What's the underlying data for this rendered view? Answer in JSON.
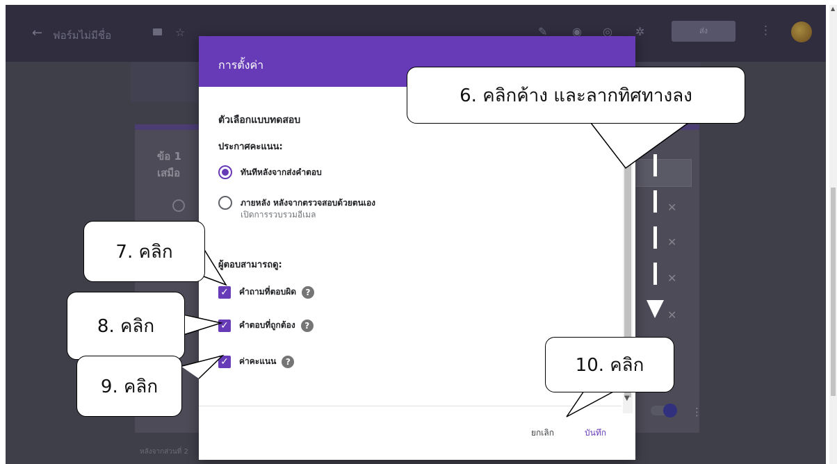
{
  "app": {
    "back_glyph": "←",
    "title": "ฟอร์มไม่มีชื่อ",
    "star_glyph": "☆",
    "send_label": "ส่ง",
    "more_glyph": "⋮",
    "footer_text": "หลังจากส่วนที่ 2",
    "question_number": "ข้อ 1",
    "question_text": "เสมือ"
  },
  "dialog": {
    "title": "การตั้งค่า",
    "section_title": "ตัวเลือกแบบทดสอบ",
    "release_label": "ประกาศคะแนน:",
    "release_options": [
      {
        "label": "ทันทีหลังจากส่งคำตอบ",
        "sub": "",
        "selected": true
      },
      {
        "label": "ภายหลัง หลังจากตรวจสอบด้วยตนเอง",
        "sub": "เปิดการรวบรวมอีเมล",
        "selected": false
      }
    ],
    "can_see_label": "ผู้ตอบสามารถดู:",
    "can_see_options": [
      {
        "label": "คำถามที่ตอบผิด",
        "checked": true
      },
      {
        "label": "คำตอบที่ถูกต้อง",
        "checked": true
      },
      {
        "label": "ค่าคะแนน",
        "checked": true
      }
    ],
    "cancel_label": "ยกเลิก",
    "save_label": "บันทึก",
    "check_glyph": "✓",
    "help_glyph": "?"
  },
  "annotations": {
    "step6": "6. คลิกค้าง และลากทิศทางลง",
    "step7": "7. คลิก",
    "step8": "8. คลิก",
    "step9": "9. คลิก",
    "step10": "10. คลิก"
  },
  "colors": {
    "accent": "#673ab7",
    "header_bg": "#2f2d3e",
    "overlay_bg": "#3e3f49"
  }
}
